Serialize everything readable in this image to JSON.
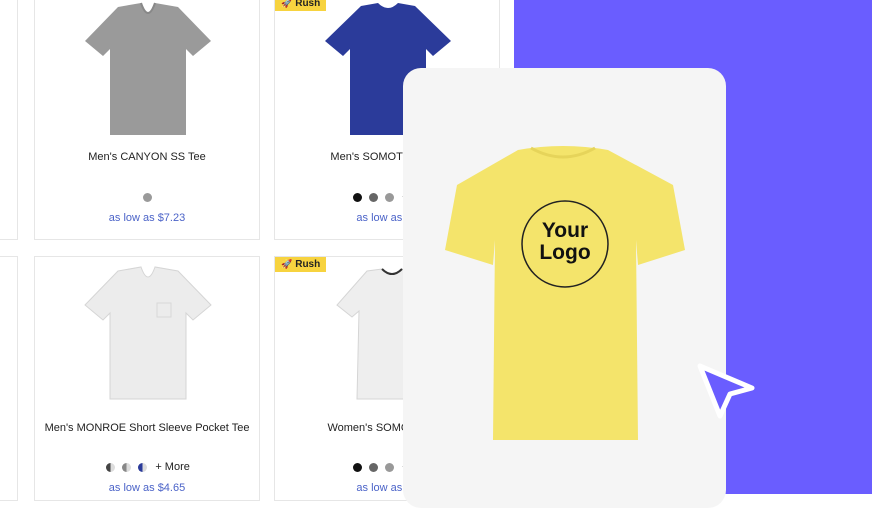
{
  "products": [
    {
      "title": "Men's CANYON SS Tee",
      "price": "as low as $7.23",
      "more": ""
    },
    {
      "title": "Men's SOMOTO Eco S",
      "price": "as low as $7",
      "rush": "Rush",
      "more": "+"
    },
    {
      "title": "Men's MONROE Short Sleeve Pocket Tee",
      "price": "as low as $4.65",
      "more": "+ More"
    },
    {
      "title": "Women's SOMOTO Eco",
      "price": "as low as $7",
      "rush": "Rush",
      "more": "+"
    }
  ],
  "overlay": {
    "logo_line1": "Your",
    "logo_line2": "Logo"
  },
  "colors": {
    "accent_bg": "#6a5dff",
    "rush_bg": "#f7d33f",
    "price": "#4b63c8",
    "shirt_yellow": "#f4e46b"
  }
}
